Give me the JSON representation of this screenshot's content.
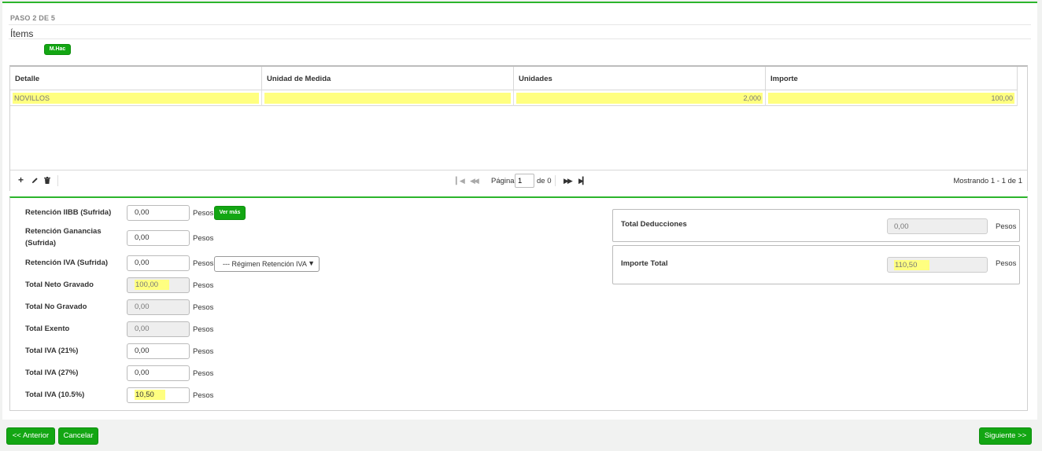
{
  "step": {
    "label": "PASO 2 DE 5",
    "title": "Ítems",
    "mhac_label": "M.Hac"
  },
  "grid": {
    "columns": [
      "Detalle",
      "Unidad de Medida",
      "Unidades",
      "Importe"
    ],
    "rows": [
      {
        "detalle": "NOVILLOS",
        "unidad": "",
        "unidades": "2,000",
        "importe": "100,00"
      }
    ],
    "pager": {
      "page_label": "Página",
      "page_value": "1",
      "of_label": "de 0",
      "showing": "Mostrando 1 - 1 de 1"
    },
    "icons": [
      "plus-icon",
      "pencil-icon",
      "trash-icon",
      "first-page-icon",
      "prev-page-icon",
      "next-page-icon",
      "last-page-icon"
    ]
  },
  "form": {
    "currency": "Pesos",
    "ver_mas": "Ver más",
    "regimen_placeholder": "--- Régimen Retención IVA",
    "fields": [
      {
        "label": "Retención IIBB (Sufrida)",
        "value": "0,00"
      },
      {
        "label": "Retención Ganancias (Sufrida)",
        "value": "0,00"
      },
      {
        "label": "Retención IVA (Sufrida)",
        "value": "0,00"
      },
      {
        "label": "Total Neto Gravado",
        "value": "100,00"
      },
      {
        "label": "Total No Gravado",
        "value": "0,00"
      },
      {
        "label": "Total Exento",
        "value": "0,00"
      },
      {
        "label": "Total IVA (21%)",
        "value": "0,00"
      },
      {
        "label": "Total IVA (27%)",
        "value": "0,00"
      },
      {
        "label": "Total IVA (10.5%)",
        "value": "10,50"
      }
    ]
  },
  "summary": {
    "deducciones_label": "Total Deducciones",
    "deducciones_value": "0,00",
    "importe_label": "Importe Total",
    "importe_value": "110,50"
  },
  "buttons": {
    "anterior": "<< Anterior",
    "cancelar": "Cancelar",
    "siguiente": "Siguiente >>"
  },
  "colors": {
    "accent": "#13a613",
    "highlight": "#ffff80"
  }
}
